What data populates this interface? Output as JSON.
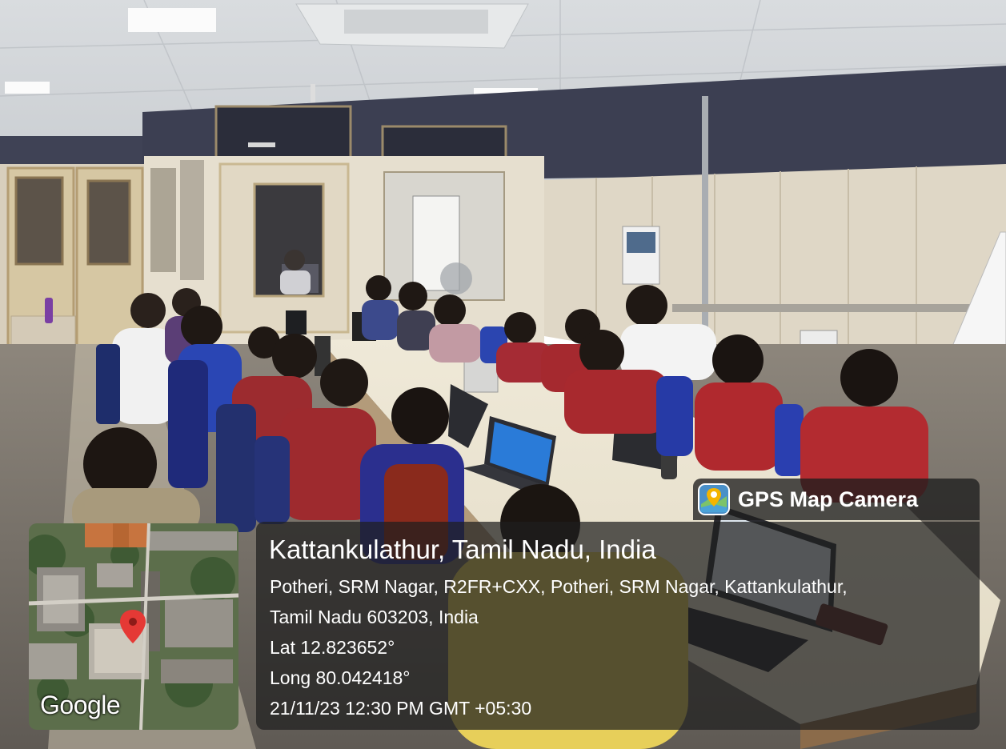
{
  "badge": {
    "title": "GPS Map Camera",
    "icon": "gps-map-pin-icon"
  },
  "map": {
    "provider_logo": "Google",
    "marker_icon": "red-location-pin-icon"
  },
  "location": {
    "title": "Kattankulathur, Tamil Nadu, India",
    "address_line_1": "Potheri, SRM Nagar, R2FR+CXX, Potheri, SRM Nagar, Kattankulathur,",
    "address_line_2": "Tamil Nadu 603203, India",
    "latitude": "Lat 12.823652°",
    "longitude": "Long 80.042418°",
    "timestamp": "21/11/23 12:30 PM GMT +05:30"
  },
  "colors": {
    "overlay": "#1e1e1e",
    "overlay_text": "#ffffff",
    "map_pin": "#e53935"
  }
}
